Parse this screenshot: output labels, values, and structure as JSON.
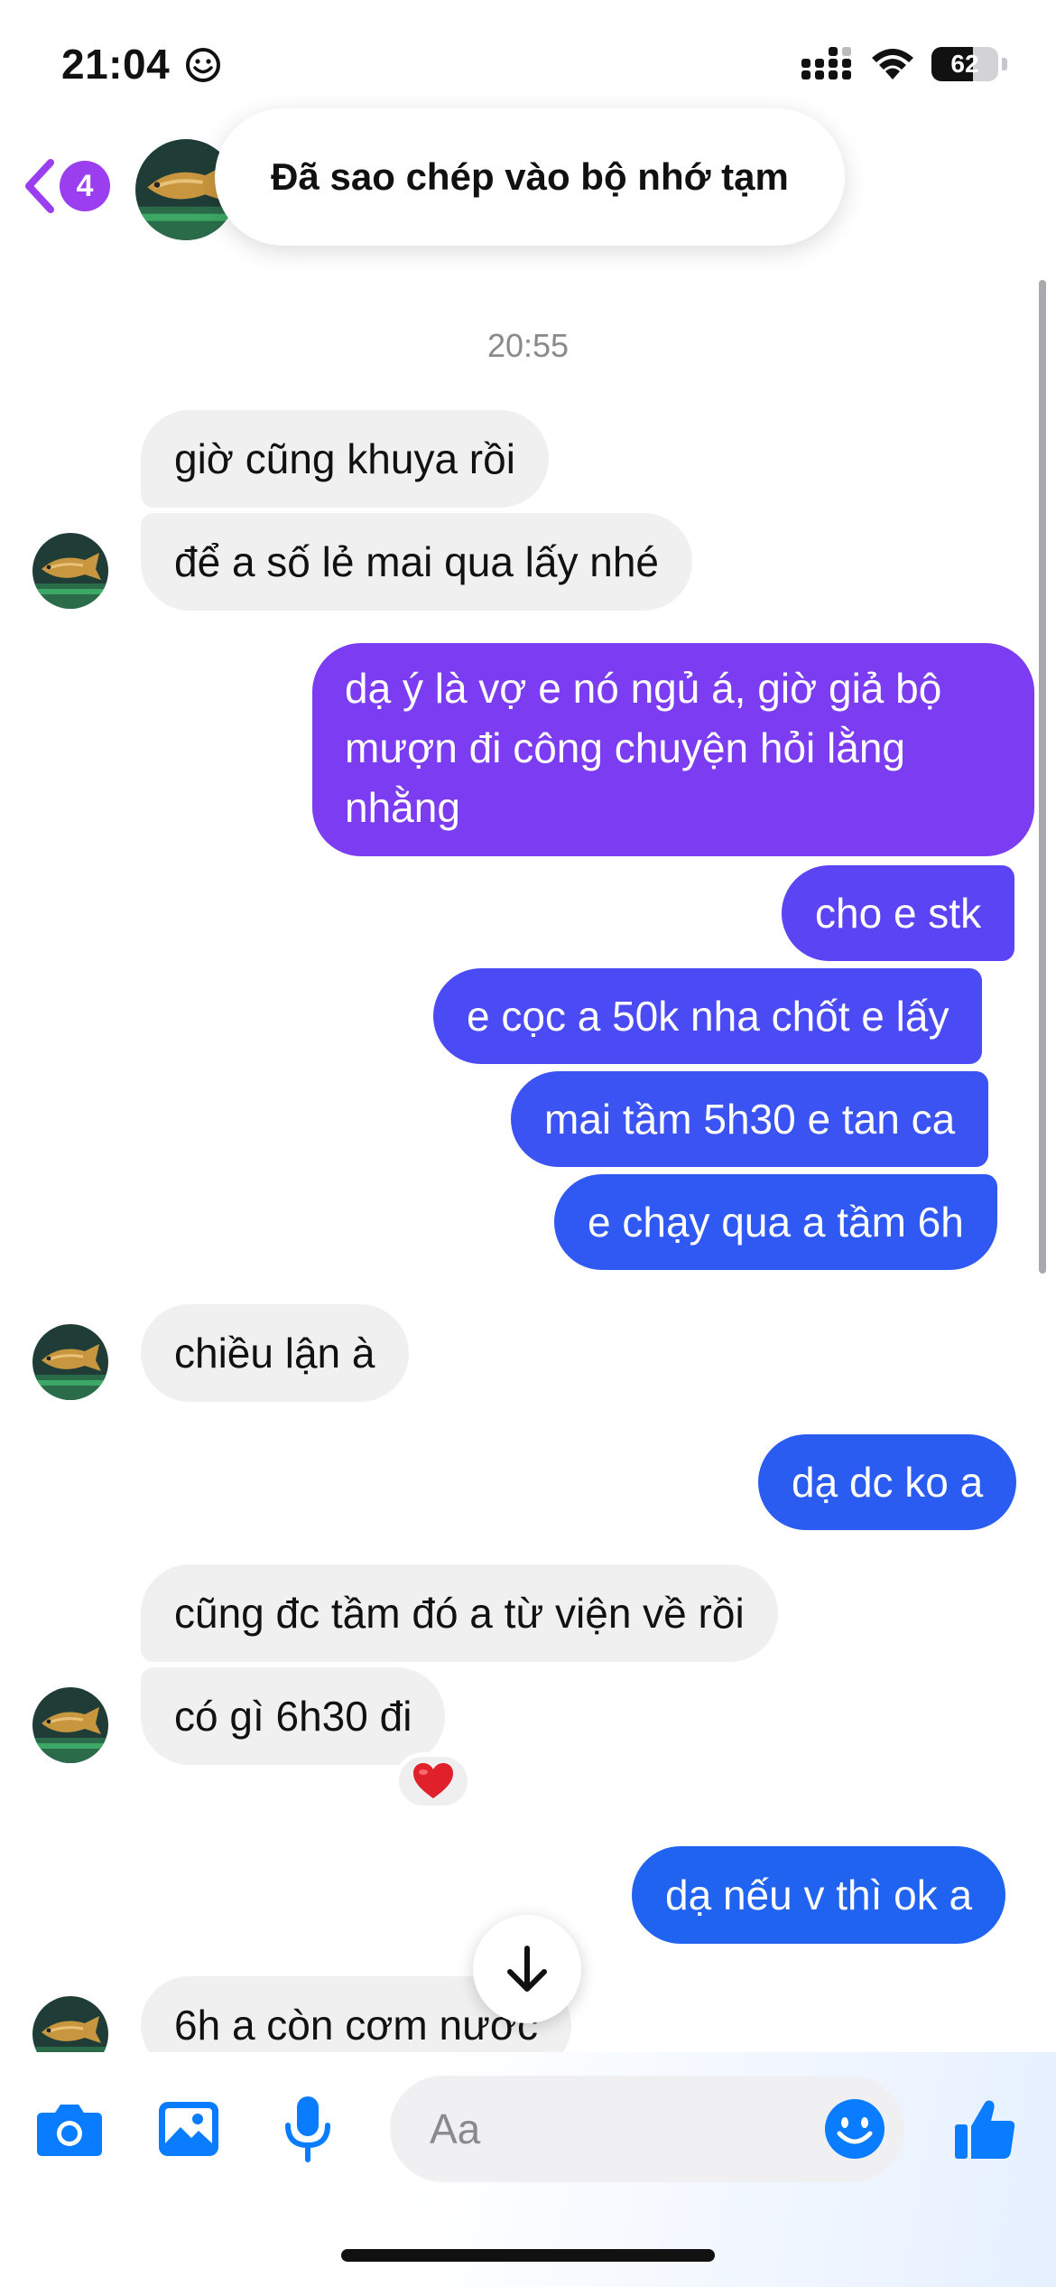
{
  "status_bar": {
    "time": "21:04",
    "battery_level": "62"
  },
  "header": {
    "back_badge_count": "4",
    "contact_avatar": "arowana-fish-avatar"
  },
  "toast": {
    "text": "Đã sao chép vào bộ nhớ tạm"
  },
  "chat": {
    "timestamp": "20:55",
    "messages": [
      {
        "from": "them",
        "text": "giờ cũng khuya rồi"
      },
      {
        "from": "them",
        "text": "để a số lẻ mai qua lấy nhé"
      },
      {
        "from": "me",
        "lines": [
          "dạ ý là vợ e nó ngủ á, giờ giả bộ",
          "mượn đi công chuyện hỏi lằng",
          "nhằng"
        ]
      },
      {
        "from": "me",
        "text": "cho e stk"
      },
      {
        "from": "me",
        "text": "e cọc a 50k nha chốt e lấy"
      },
      {
        "from": "me",
        "text": "mai tầm 5h30 e tan ca"
      },
      {
        "from": "me",
        "text": "e chạy qua a tầm 6h"
      },
      {
        "from": "them",
        "text": "chiều lận à"
      },
      {
        "from": "me",
        "text": "dạ dc ko a"
      },
      {
        "from": "them",
        "text": "cũng đc tầm đó a từ viện về rồi"
      },
      {
        "from": "them",
        "text": "có gì 6h30 đi",
        "reaction": "red-heart"
      },
      {
        "from": "me",
        "text": "dạ nếu v thì ok a"
      },
      {
        "from": "them",
        "text": "6h a còn cơm nước"
      }
    ]
  },
  "composer": {
    "placeholder": "Aa"
  },
  "colors": {
    "accent_purple": "#9b3ef0",
    "bubble_gradient_top": "#7b3cf2",
    "bubble_gradient_bottom": "#1f63f0",
    "messenger_blue": "#0a7cff",
    "incoming_bubble": "#f0f0f0"
  }
}
